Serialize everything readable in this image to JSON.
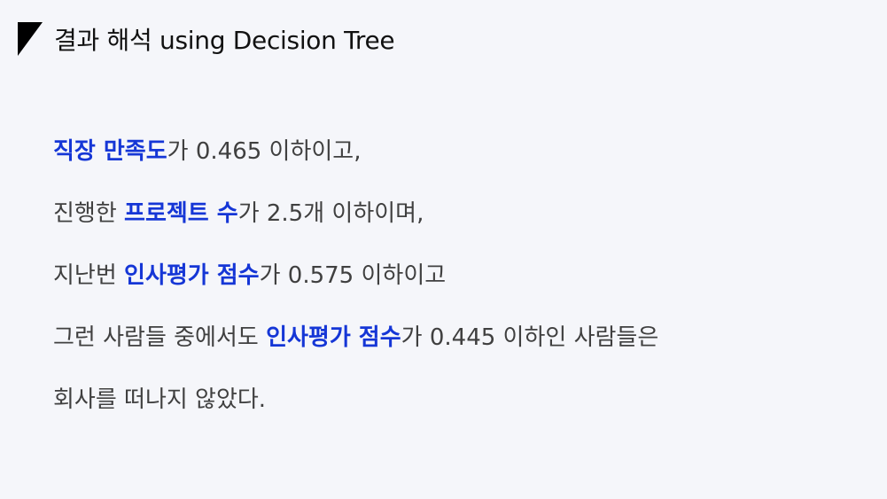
{
  "title": "결과 해석 using Decision Tree",
  "lines": [
    [
      {
        "text": "직장 만족도",
        "highlight": true
      },
      {
        "text": "가 0.465 이하이고,",
        "highlight": false
      }
    ],
    [
      {
        "text": "진행한 ",
        "highlight": false
      },
      {
        "text": "프로젝트 수",
        "highlight": true
      },
      {
        "text": "가 2.5개 이하이며,",
        "highlight": false
      }
    ],
    [
      {
        "text": "지난번 ",
        "highlight": false
      },
      {
        "text": "인사평가 점수",
        "highlight": true
      },
      {
        "text": "가 0.575 이하이고",
        "highlight": false
      }
    ],
    [
      {
        "text": "그런 사람들 중에서도 ",
        "highlight": false
      },
      {
        "text": "인사평가 점수",
        "highlight": true
      },
      {
        "text": "가 0.445 이하인 사람들은",
        "highlight": false
      }
    ],
    [
      {
        "text": "회사를 떠나지 않았다.",
        "highlight": false
      }
    ]
  ],
  "colors": {
    "background": "#f5f6fa",
    "highlight": "#1536d6",
    "body_text": "#404040",
    "title_text": "#111111",
    "corner_mark": "#000000"
  },
  "icons": {
    "corner_mark": "black-corner-triangle-icon"
  }
}
